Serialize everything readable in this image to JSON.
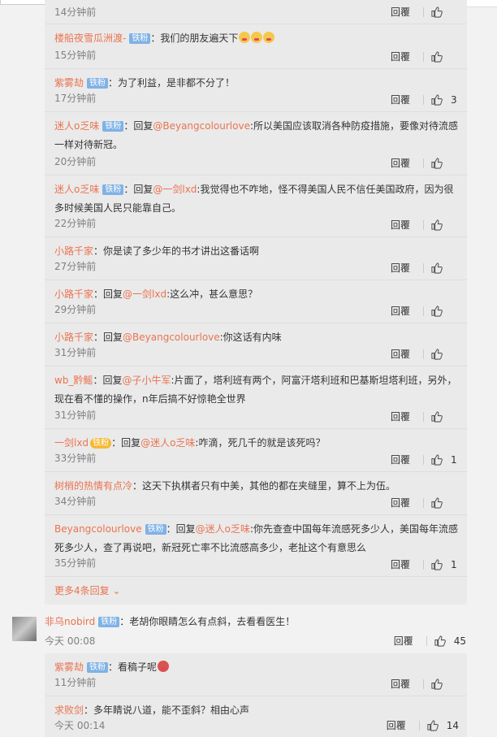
{
  "actions": {
    "reply_label": "回覆"
  },
  "replies": [
    {
      "name": "",
      "badge": "",
      "text": "",
      "time": "14分钟前",
      "likes": ""
    },
    {
      "name": "楼船夜雪瓜洲渡-",
      "badge": "铁粉",
      "text": "：我们的朋友遍天下",
      "time": "15分钟前",
      "likes": ""
    },
    {
      "name": "紫雾劫",
      "badge": "铁粉",
      "text": "：为了利益，是非都不分了！",
      "time": "17分钟前",
      "likes": "3"
    },
    {
      "name": "迷人o乏味",
      "badge": "铁粉",
      "prefix": "：回复",
      "mention": "@Beyangcolourlove",
      "text": ":所以美国应该取消各种防疫措施，要像对待流感一样对待新冠。",
      "time": "20分钟前",
      "likes": ""
    },
    {
      "name": "迷人o乏味",
      "badge": "铁粉",
      "prefix": "：回复",
      "mention": "@一剑lxd",
      "text": ":我觉得也不咋地，怪不得美国人民不信任美国政府，因为很多时候美国人民只能靠自己。",
      "time": "22分钟前",
      "likes": ""
    },
    {
      "name": "小路千家",
      "badge": "",
      "text": "：你是读了多少年的书才讲出这番话啊",
      "time": "27分钟前",
      "likes": ""
    },
    {
      "name": "小路千家",
      "badge": "",
      "prefix": "：回复",
      "mention": "@一剑lxd",
      "text": ":这么冲，甚么意思？",
      "time": "29分钟前",
      "likes": ""
    },
    {
      "name": "小路千家",
      "badge": "",
      "prefix": "：回复",
      "mention": "@Beyangcolourlove",
      "text": ":你这话有内味",
      "time": "31分钟前",
      "likes": ""
    },
    {
      "name": "wb_黔鳐",
      "badge": "",
      "prefix": "：回复",
      "mention": "@子小牛军",
      "text": ":片面了，塔利班有两个，阿富汗塔利班和巴基斯坦塔利班，另外，现在看不懂的操作，n年后搞不好惊艳全世界",
      "time": "31分钟前",
      "likes": ""
    },
    {
      "name": "一剑lxd",
      "badge": "铁粉",
      "prefix": "：回复",
      "mention": "@迷人o乏味",
      "text": ":咋滴，死几千的就是该死吗？",
      "time": "33分钟前",
      "likes": "1"
    },
    {
      "name": "树梢的热情有点冷",
      "badge": "",
      "text": "：这天下执棋者只有中美，其他的都在夹缝里，算不上为伍。",
      "time": "34分钟前",
      "likes": ""
    },
    {
      "name": "Beyangcolourlove",
      "badge": "铁粉",
      "prefix": "：回复",
      "mention": "@迷人o乏味",
      "text": ":你先查查中国每年流感死多少人，美国每年流感死多少人，查了再说吧，新冠死亡率不比流感高多少，老扯这个有意思么",
      "time": "35分钟前",
      "likes": "1"
    }
  ],
  "more_replies": "更多4条回复 ⌄",
  "main_comment": {
    "name": "非乌nobird",
    "badge": "铁粉",
    "text": "：老胡你眼睛怎么有点斜，去看看医生！",
    "time": "今天 00:08",
    "likes": "45"
  },
  "sub_replies": [
    {
      "name": "紫雾劫",
      "badge": "铁粉",
      "text": "：看稿子呢",
      "time": "11分钟前",
      "likes": ""
    },
    {
      "name": "求败剑",
      "badge": "",
      "text": "：多年睛说八道，能不歪斜？相由心声",
      "time": "今天 00:14",
      "likes": "14"
    }
  ]
}
